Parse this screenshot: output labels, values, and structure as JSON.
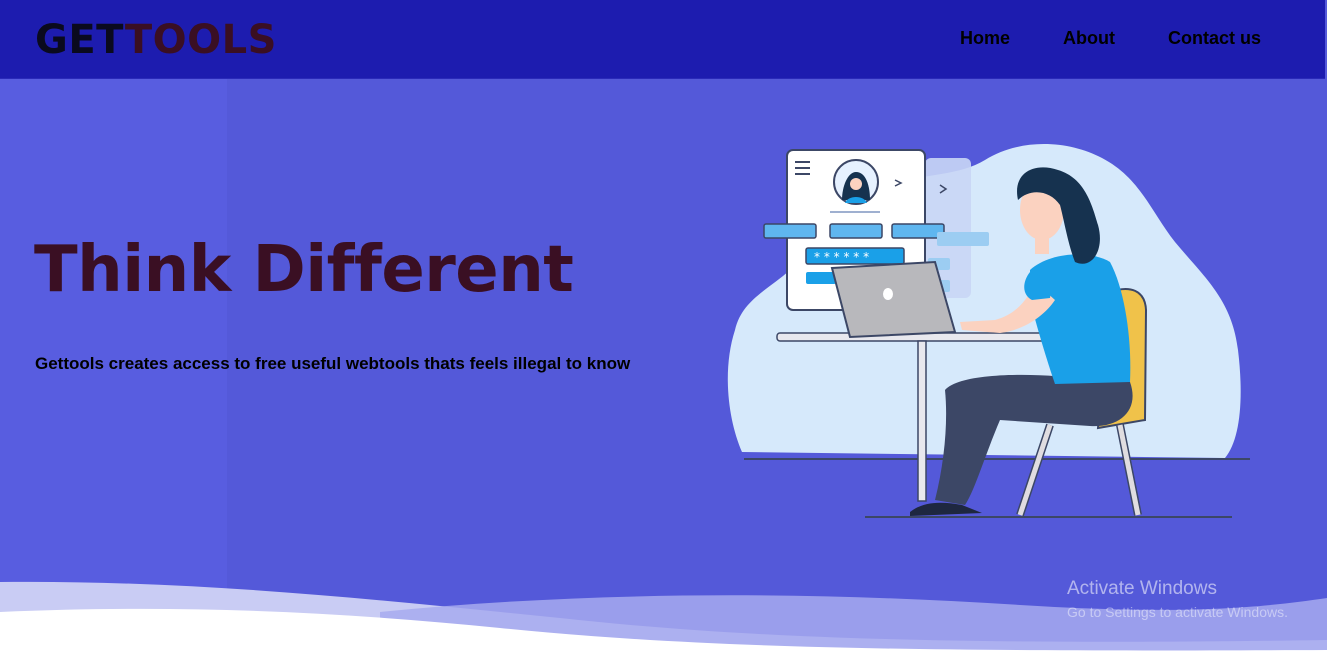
{
  "navbar": {
    "logo_part1": "GET",
    "logo_part2": "TOOLS",
    "links": {
      "home": "Home",
      "about": "About",
      "contact": "Contact us"
    }
  },
  "hero": {
    "title": "Think Different",
    "subtitle": "Gettools creates access to free useful webtools thats feels illegal to know"
  },
  "watermark": {
    "line1": "Activate Windows",
    "line2": "Go to Settings to activate Windows."
  },
  "colors": {
    "navbar_bg": "#1d1caf",
    "hero_bg": "#5459d9",
    "title_color": "#3a0f23",
    "figure_shirt": "#1aa0e8",
    "chair": "#f0c24a"
  }
}
